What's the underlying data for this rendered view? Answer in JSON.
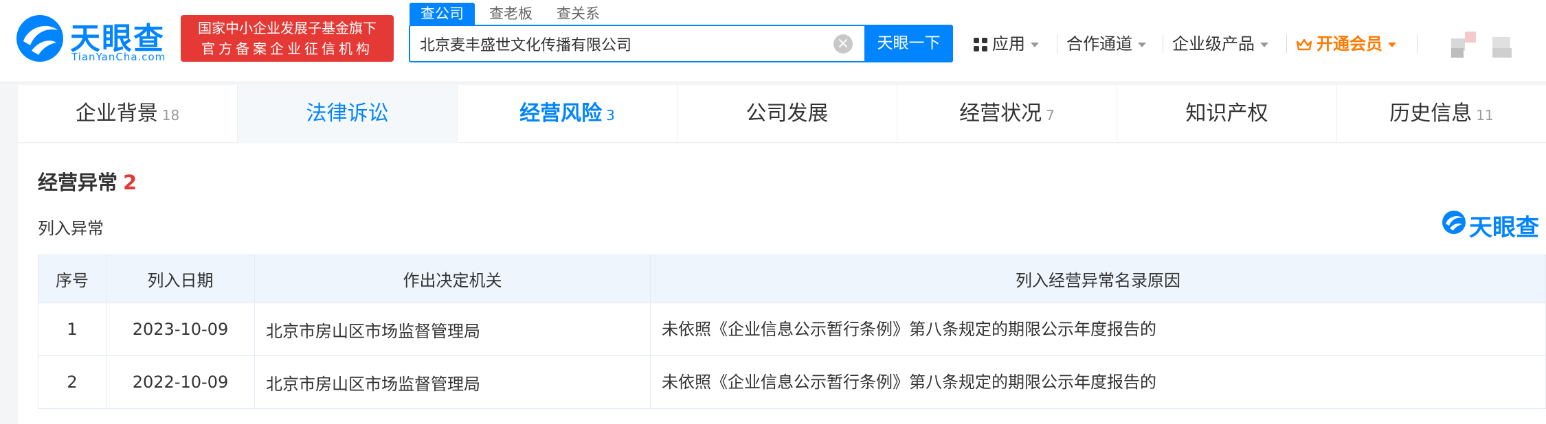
{
  "header": {
    "logo_title": "天眼查",
    "logo_sub": "TianYanCha.com",
    "badge_line1": "国家中小企业发展子基金旗下",
    "badge_line2": "官方备案企业征信机构",
    "search_tabs": [
      "查公司",
      "查老板",
      "查关系"
    ],
    "search_value": "北京麦丰盛世文化传播有限公司",
    "search_button": "天眼一下",
    "nav": {
      "apps": "应用",
      "partner": "合作通道",
      "enterprise": "企业级产品",
      "vip": "开通会员"
    }
  },
  "tabs": [
    {
      "label": "企业背景",
      "count": "18"
    },
    {
      "label": "法律诉讼",
      "count": ""
    },
    {
      "label": "经营风险",
      "count": "3"
    },
    {
      "label": "公司发展",
      "count": ""
    },
    {
      "label": "经营状况",
      "count": "7"
    },
    {
      "label": "知识产权",
      "count": ""
    },
    {
      "label": "历史信息",
      "count": "11"
    }
  ],
  "section": {
    "title": "经营异常",
    "count": "2",
    "subtitle": "列入异常",
    "watermark": "天眼查"
  },
  "table": {
    "headers": [
      "序号",
      "列入日期",
      "作出决定机关",
      "列入经营异常名录原因"
    ],
    "rows": [
      {
        "no": "1",
        "date": "2023-10-09",
        "authority": "北京市房山区市场监督管理局",
        "reason": "未依照《企业信息公示暂行条例》第八条规定的期限公示年度报告的"
      },
      {
        "no": "2",
        "date": "2022-10-09",
        "authority": "北京市房山区市场监督管理局",
        "reason": "未依照《企业信息公示暂行条例》第八条规定的期限公示年度报告的"
      }
    ]
  },
  "colors": {
    "brand": "#0084ff",
    "badge": "#e53935",
    "vip": "#ff7a00",
    "count_red": "#e53935"
  }
}
